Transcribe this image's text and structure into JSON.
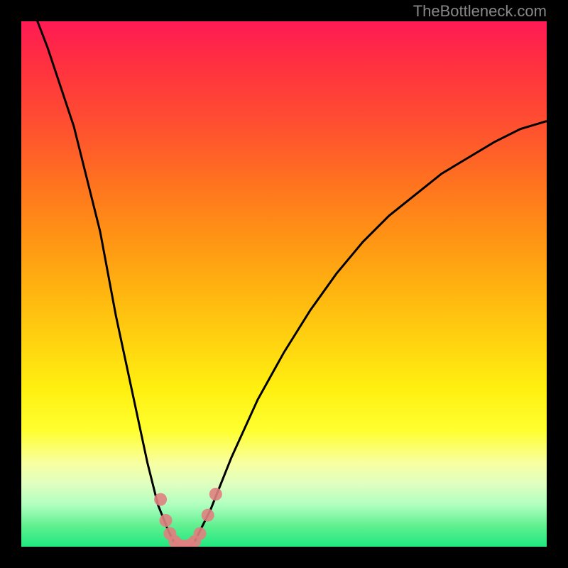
{
  "watermark": "TheBottleneck.com",
  "chart_data": {
    "type": "line",
    "title": "",
    "xlabel": "",
    "ylabel": "",
    "xlim": [
      0,
      100
    ],
    "ylim": [
      0,
      100
    ],
    "background_gradient": [
      "#ff1a55",
      "#ff9015",
      "#ffff30",
      "#20e880"
    ],
    "series": [
      {
        "name": "bottleneck-curve",
        "color": "#000000",
        "x": [
          0,
          5,
          10,
          15,
          18,
          21,
          24,
          26,
          28,
          29,
          30,
          31,
          32,
          33,
          34,
          36,
          40,
          45,
          50,
          55,
          60,
          65,
          70,
          75,
          80,
          85,
          90,
          95,
          100
        ],
        "y": [
          108,
          95,
          80,
          60,
          44,
          30,
          16,
          8,
          3,
          1,
          0,
          0,
          0,
          1,
          3,
          7,
          17,
          28,
          37,
          45,
          52,
          58,
          63,
          67,
          71,
          74,
          77,
          79.5,
          81
        ]
      }
    ],
    "markers": [
      {
        "x": 26.5,
        "y": 9
      },
      {
        "x": 27.5,
        "y": 5
      },
      {
        "x": 28.3,
        "y": 2.5
      },
      {
        "x": 29.2,
        "y": 1.0
      },
      {
        "x": 30.0,
        "y": 0.3
      },
      {
        "x": 31.0,
        "y": 0.1
      },
      {
        "x": 32.0,
        "y": 0.3
      },
      {
        "x": 33.0,
        "y": 1.0
      },
      {
        "x": 34.0,
        "y": 2.5
      },
      {
        "x": 35.5,
        "y": 6
      },
      {
        "x": 37.0,
        "y": 10
      }
    ],
    "marker_color": "#e08080",
    "marker_radius": 9
  }
}
